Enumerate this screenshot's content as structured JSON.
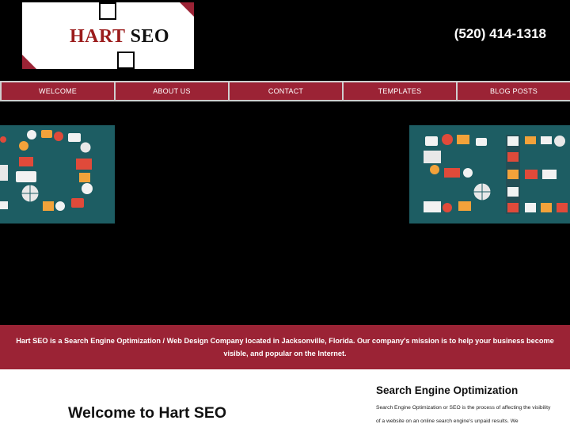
{
  "header": {
    "logo_word1": "HART",
    "logo_word2": "SEO",
    "phone": "(520) 414-1318"
  },
  "nav": {
    "items": [
      "WELCOME",
      "ABOUT US",
      "CONTACT",
      "TEMPLATES",
      "BLOG POSTS"
    ]
  },
  "colors": {
    "brand_red": "#9b2335",
    "banner_teal": "#1d5d63",
    "page_background": "#000000"
  },
  "mission": {
    "text": "Hart SEO is a Search Engine Optimization / Web Design Company located in Jacksonville, Florida. Our company's mission is to help your business become visible, and popular on the Internet."
  },
  "content": {
    "welcome_heading": "Welcome to Hart SEO",
    "side_heading": "Search Engine Optimization",
    "side_text": "Search Engine Optimization or SEO is the process of affecting the visibility of a website on an online search engine's unpaid results. We"
  }
}
